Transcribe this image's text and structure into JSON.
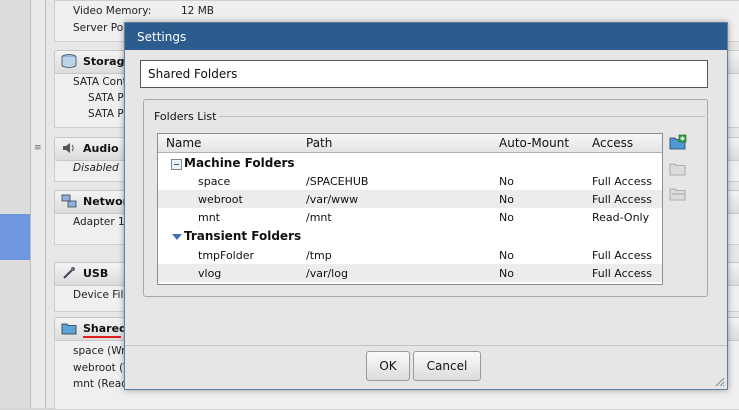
{
  "background": {
    "video_memory_label": "Video Memory:",
    "video_memory_value": "12 MB",
    "server_port_label": "Server Por",
    "storage": {
      "title": "Storage",
      "lines": [
        "SATA Contr",
        "SATA P",
        "SATA P"
      ]
    },
    "audio": {
      "title": "Audio",
      "lines": [
        "Disabled"
      ]
    },
    "network": {
      "title": "Networ",
      "lines": [
        "Adapter 1"
      ]
    },
    "usb": {
      "title": "USB",
      "lines": [
        "Device Filt"
      ]
    },
    "shared": {
      "title": "Shared",
      "lines": [
        "space (Wr",
        "webroot (V",
        "mnt (Read-Only)"
      ]
    }
  },
  "dialog": {
    "title": "Settings",
    "page_header": "Shared Folders",
    "group_label": "Folders List",
    "columns": [
      "Name",
      "Path",
      "Auto-Mount",
      "Access"
    ],
    "groups": [
      {
        "label": "Machine Folders",
        "rows": [
          {
            "name": "space",
            "path": "/SPACEHUB",
            "auto_mount": "No",
            "access": "Full Access"
          },
          {
            "name": "webroot",
            "path": "/var/www",
            "auto_mount": "No",
            "access": "Full Access"
          },
          {
            "name": "mnt",
            "path": "/mnt",
            "auto_mount": "No",
            "access": "Read-Only"
          }
        ]
      },
      {
        "label": "Transient Folders",
        "rows": [
          {
            "name": "tmpFolder",
            "path": "/tmp",
            "auto_mount": "No",
            "access": "Full Access"
          },
          {
            "name": "vlog",
            "path": "/var/log",
            "auto_mount": "No",
            "access": "Full Access"
          }
        ]
      }
    ],
    "side_buttons": [
      "add-folder-icon",
      "edit-folder-icon",
      "remove-folder-icon"
    ],
    "ok_label": "OK",
    "cancel_label": "Cancel"
  },
  "colors": {
    "titlebar": "#2c5b8d",
    "selection_accent": "#6e97e0",
    "shared_underline": "#e02020"
  }
}
